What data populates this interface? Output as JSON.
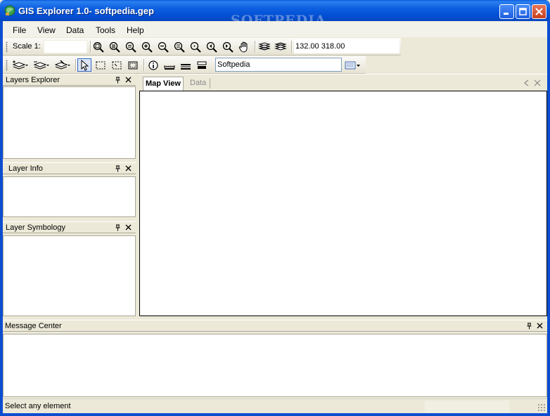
{
  "window": {
    "title": "GIS Explorer 1.0- softpedia.gep",
    "watermark": "SOFTPEDIA"
  },
  "menu": {
    "items": [
      "File",
      "View",
      "Data",
      "Tools",
      "Help"
    ]
  },
  "toolbar_main": {
    "scale_label": "Scale 1:",
    "scale_value": "",
    "coords": "132.00 318.00"
  },
  "toolbar_select": {
    "search_value": "Softpedia"
  },
  "panes": {
    "layers_explorer": "Layers Explorer",
    "layer_info": "Layer Info",
    "layer_symbology": "Layer Symbology"
  },
  "map": {
    "tabs": [
      {
        "label": "Map View",
        "active": true
      },
      {
        "label": "Data",
        "active": false
      }
    ]
  },
  "message_center": {
    "title": "Message Center"
  },
  "status": {
    "text": "Select any element"
  },
  "colors": {
    "titlebar": "#0451d6",
    "selection_border": "#316ac5",
    "panel_bg": "#ece9d8"
  }
}
